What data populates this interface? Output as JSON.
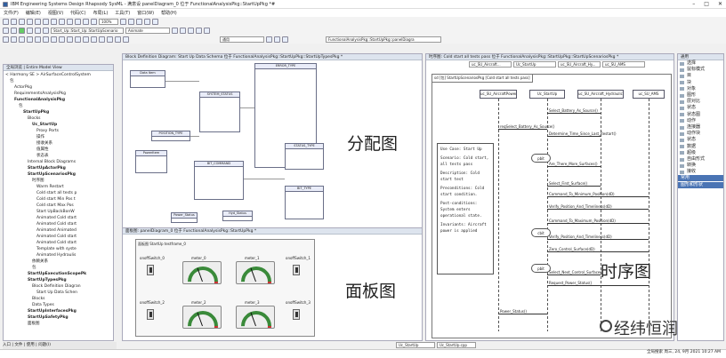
{
  "window": {
    "title": "IBM Engineering Systems Design Rhapsody SysML - 满意设 panelDiagram_0 位于 FunctionalAnalysisPkg::StartUpPkg *#"
  },
  "menu": [
    "文件(F)",
    "编辑(E)",
    "视图(V)",
    "代码(C)",
    "布局(L)",
    "工具(T)",
    "窗口(W)",
    "帮助(H)"
  ],
  "toolbar": {
    "zoom": "100%",
    "combo1": "Start_Up::Start_Up::StartUpScenario",
    "combo2": "Animate",
    "combo3": "通用",
    "combo4": "FunctionalAnalysisPkg::StartUpPkg::panelDiagra"
  },
  "browser": {
    "title": "全局浏览 | Entire Model View",
    "items": [
      {
        "t": "< Harmony SE > AirSurfaceControlSystem",
        "i": 0
      },
      {
        "t": "包",
        "i": 1
      },
      {
        "t": "ActorPkg",
        "i": 2
      },
      {
        "t": "RequirementsAnalysisPkg",
        "i": 2
      },
      {
        "t": "FunctionalAnalysisPkg",
        "i": 2,
        "b": true
      },
      {
        "t": "包",
        "i": 3
      },
      {
        "t": "StartUpPkg",
        "i": 4,
        "b": true
      },
      {
        "t": "Blocks",
        "i": 5
      },
      {
        "t": "Uc_StartUp",
        "i": 6,
        "b": true
      },
      {
        "t": "Proxy Ports",
        "i": 7
      },
      {
        "t": "操作",
        "i": 7
      },
      {
        "t": "接收关系",
        "i": 7
      },
      {
        "t": "值属性",
        "i": 7
      },
      {
        "t": "状态表",
        "i": 7
      },
      {
        "t": "Internal Block Diagrams",
        "i": 5
      },
      {
        "t": "StartUpActorPkg",
        "i": 5,
        "b": true
      },
      {
        "t": "StartUpScenariosPkg",
        "i": 5,
        "b": true
      },
      {
        "t": "时序图",
        "i": 6
      },
      {
        "t": "Warm Restart",
        "i": 7
      },
      {
        "t": "Cold start all tests p",
        "i": 7
      },
      {
        "t": "Cold start Min Pos t",
        "i": 7
      },
      {
        "t": "Cold start Max Pos",
        "i": 7
      },
      {
        "t": "Start UpBackBonW",
        "i": 7
      },
      {
        "t": "Animated Cold start",
        "i": 7
      },
      {
        "t": "Animated Cold start",
        "i": 7
      },
      {
        "t": "Animated Animated",
        "i": 7
      },
      {
        "t": "Animated Cold start",
        "i": 7
      },
      {
        "t": "Animated Cold start",
        "i": 7
      },
      {
        "t": "Template with syste",
        "i": 7
      },
      {
        "t": "Animated Hydraulis",
        "i": 7
      },
      {
        "t": "依赖关系",
        "i": 6
      },
      {
        "t": "包",
        "i": 6
      },
      {
        "t": "StartUpExecutionScopePk",
        "i": 5,
        "b": true
      },
      {
        "t": "StartUpTypesPkg",
        "i": 5,
        "b": true
      },
      {
        "t": "Block Definition Diagran",
        "i": 6
      },
      {
        "t": "Start Up Data Schen",
        "i": 7
      },
      {
        "t": "Blocks",
        "i": 6
      },
      {
        "t": "Data Types",
        "i": 6
      },
      {
        "t": "StartUpInterfacesPkg",
        "i": 5,
        "b": true
      },
      {
        "t": "StartUpSafetyPkg",
        "i": 5,
        "b": true
      },
      {
        "t": "面板图",
        "i": 5
      }
    ]
  },
  "bdd": {
    "title": "Block Definition Diagram: Start Up Data Schema 位于 FunctionalAnalysisPkg::StartUpPkg::StartUpTypesPkg *",
    "overlay": "分配图",
    "boxes": {
      "b1": "Data Item",
      "b2": "ERROR_TYPE",
      "b3": "SYSTEM_STATUS",
      "b4": "POSITION_TYPE",
      "b5": "Power_Status",
      "b6": "BIT_COMMAND",
      "b7": "BIT_TYPE",
      "b8": "STATUS_TYPE",
      "b9": "PowerItem",
      "b10": "Hyd_Status"
    }
  },
  "panel": {
    "title": "面板图: panelDiagram_0 位于 FunctionalAnalysisPkg::StartUpPkg *",
    "inner": "面板图 StartUp testframe_0",
    "overlay": "面板图",
    "switches": [
      "onoffSwitch_0",
      "onoffSwitch_2",
      "onoffSwitch_1",
      "onoffSwitch_3"
    ],
    "meters": [
      "meter_0",
      "meter_1",
      "meter_2",
      "meter_3"
    ]
  },
  "seq": {
    "title": "时序图: Cold start all tests pass 位于 FunctionalAnalysisPkg::StartUpPkg::StartUpScenariosPkg *",
    "overlay": "时序图",
    "header": "sd [包] StartUpScenariosPkg [Cold start all tests pass]",
    "lifelines": [
      "uc_SU_AircraftPower",
      "Uc_StartUp",
      "uc_SU_Aircraft_Hydraulics",
      "uc_SU_AMS"
    ],
    "toptabs": [
      "uc_SU_Aircraft...",
      "Uc_StartUp",
      "uc_SU_Aircraft_Hy...",
      "uc_SU_AMS"
    ],
    "messages": [
      "Select_Battery_As_Source()",
      "reqSelect_Battery_As_Source()",
      "Determine_Time_Since_Last_Restart()",
      "Are_There_More_Surfaces()",
      "Select_First_Surface()",
      "Command_To_Minimum_Position(dD)",
      "Verify_Position_And_Timeliness(dD)",
      "Command_To_Maximum_Position(dD)",
      "Verify_Position_And_Timeliness(dD)",
      "Zero_Control_Surface(dD)",
      "Select_Next_Control_Surface()",
      "Request_Power_Status()",
      "Power_Status()"
    ],
    "frames": [
      "pbit",
      "cbit",
      "pbit"
    ],
    "note": [
      "Use Case: Start Up",
      "Scenario: Cold start, all tests pass",
      "Description: Cold start test",
      "Preconditions: Cold start condition.",
      "Post-conditions: System enters operational state.",
      "Invariants: Aircraft power is applied"
    ]
  },
  "rightpanel": {
    "title": "通用",
    "items": [
      "选择",
      "鼠标模式",
      "目",
      "块",
      "对象",
      "图形",
      "层对比",
      "状态",
      "状态图",
      "动作",
      "连接器",
      "动作块",
      "状态",
      "数据",
      "超级",
      "自由形式",
      "转换",
      "接收",
      "文本",
      "图形"
    ],
    "footer1": "常用",
    "footer2": "图形和形状"
  },
  "bottomtabs": [
    "Uc_StartUp",
    "Uc_StartUp.cpp"
  ],
  "bottomleft": "入口 | 文件 | 使用 | 问题(I)",
  "status": {
    "search": "全局搜索",
    "time": "10:27 AM",
    "date": "周三, 24, 9月 2021"
  },
  "watermark": "经纬恒润"
}
